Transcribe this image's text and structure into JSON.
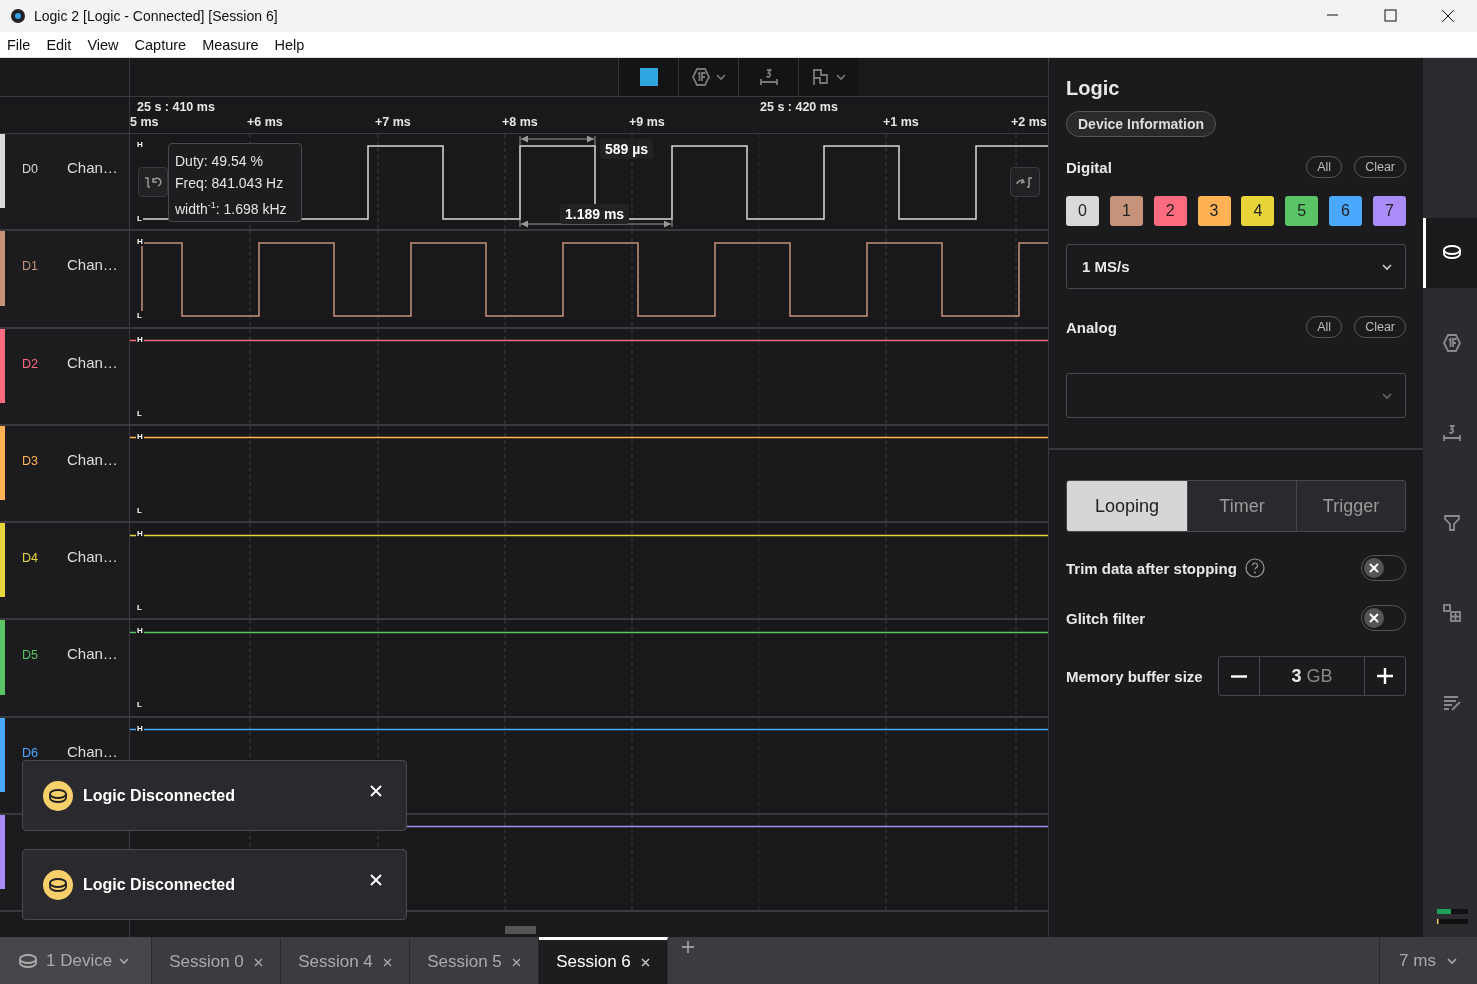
{
  "window": {
    "title": "Logic 2 [Logic - Connected] [Session 6]"
  },
  "menu": [
    "File",
    "Edit",
    "View",
    "Capture",
    "Measure",
    "Help"
  ],
  "ruler": {
    "marks": [
      "25 s : 410 ms",
      "25 s : 420 ms"
    ],
    "ticks": [
      "5 ms",
      "+6 ms",
      "+7 ms",
      "+8 ms",
      "+9 ms",
      "+1 ms",
      "+2 ms"
    ]
  },
  "channels": [
    {
      "id": "D0",
      "name": "Chan…",
      "color": "#d9d9d9",
      "kind": "pulse",
      "markers": [
        "H",
        "L"
      ]
    },
    {
      "id": "D1",
      "name": "Chan…",
      "color": "#c4937a",
      "kind": "pulse",
      "markers": [
        "H",
        "L"
      ]
    },
    {
      "id": "D2",
      "name": "Chan…",
      "color": "#ff6b7f",
      "kind": "flat",
      "markers": [
        "H",
        "L"
      ]
    },
    {
      "id": "D3",
      "name": "Chan…",
      "color": "#ffb153",
      "kind": "flat",
      "markers": [
        "H",
        "L"
      ]
    },
    {
      "id": "D4",
      "name": "Chan…",
      "color": "#e8d53a",
      "kind": "flat",
      "markers": [
        "H",
        "L"
      ]
    },
    {
      "id": "D5",
      "name": "Chan…",
      "color": "#59c567",
      "kind": "flat",
      "markers": [
        "H",
        "L"
      ]
    },
    {
      "id": "D6",
      "name": "Chan…",
      "color": "#4aa8ff",
      "kind": "flat",
      "markers": [
        "H"
      ]
    },
    {
      "color": "#a98cf7",
      "kind": "flat"
    }
  ],
  "measurement": {
    "readout": [
      "Duty: 49.54 %",
      "Freq: 841.043 Hz",
      "width$^{-1}$: 1.698 kHz"
    ],
    "width": "589 µs",
    "period": "1.189 ms"
  },
  "notifications": [
    {
      "title": "Logic Disconnected"
    },
    {
      "title": "Logic Disconnected"
    }
  ],
  "panel": {
    "title": "Logic",
    "device_button": "Device Information",
    "digital": {
      "label": "Digital",
      "all": "All",
      "clear": "Clear",
      "sample_rate": "1 MS/s",
      "channels": [
        {
          "label": "0",
          "color": "#d9d9d9"
        },
        {
          "label": "1",
          "color": "#c4937a"
        },
        {
          "label": "2",
          "color": "#ff6b7f"
        },
        {
          "label": "3",
          "color": "#ffb153"
        },
        {
          "label": "4",
          "color": "#e8d53a"
        },
        {
          "label": "5",
          "color": "#59c567"
        },
        {
          "label": "6",
          "color": "#4aa8ff"
        },
        {
          "label": "7",
          "color": "#a98cf7"
        }
      ]
    },
    "analog": {
      "label": "Analog",
      "all": "All",
      "clear": "Clear"
    },
    "modes": [
      {
        "label": "Looping",
        "selected": true
      },
      {
        "label": "Timer",
        "selected": false
      },
      {
        "label": "Trigger",
        "selected": false
      }
    ],
    "settings": [
      {
        "label": "Trim data after stopping",
        "help": true,
        "on": false
      },
      {
        "label": "Glitch filter",
        "help": false,
        "on": false
      }
    ],
    "memory": {
      "label": "Memory buffer size",
      "value": "3",
      "unit": "GB"
    }
  },
  "rail": [
    {
      "selected": true
    },
    {
      "selected": false
    },
    {
      "selected": false
    },
    {
      "selected": false
    },
    {
      "selected": false
    },
    {
      "selected": false
    }
  ],
  "session_bar": {
    "device": "1 Device",
    "sessions": [
      {
        "label": "Session 0",
        "selected": false
      },
      {
        "label": "Session 4",
        "selected": false
      },
      {
        "label": "Session 5",
        "selected": false
      },
      {
        "label": "Session 6",
        "selected": true
      }
    ],
    "zoom": "7 ms"
  }
}
